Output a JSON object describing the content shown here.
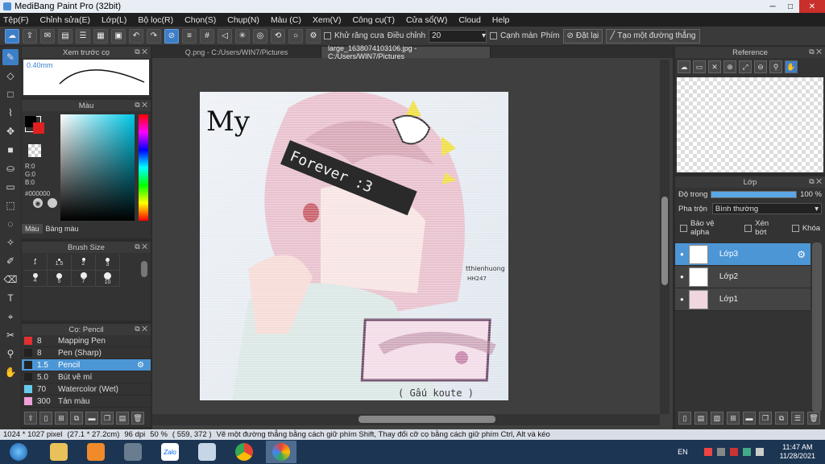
{
  "window": {
    "title": "MediBang Paint Pro (32bit)",
    "min": "─",
    "max": "□",
    "close": "✕"
  },
  "menu": [
    "Tệp(F)",
    "Chỉnh sửa(E)",
    "Lớp(L)",
    "Bộ lọc(R)",
    "Chọn(S)",
    "Chụp(N)",
    "Màu (C)",
    "Xem(V)",
    "Công cụ(T)",
    "Cửa sổ(W)",
    "Cloud",
    "Help"
  ],
  "toolbar": {
    "antialias": "Khử răng cưa",
    "adjust": "Điều chỉnh",
    "adjust_value": "20",
    "snap": "Cạnh màn",
    "key": "Phím",
    "reset": "Đặt lại",
    "straight": "Tạo một đường thẳng"
  },
  "preview": {
    "title": "Xem trước cọ",
    "size": "0.40mm"
  },
  "color": {
    "title": "Màu",
    "r": "R:0",
    "g": "G:0",
    "b": "B:0",
    "hex": "#000000",
    "tab1": "Màu",
    "tab2": "Bảng màu",
    "fg": "#000000",
    "bg": "#e02020"
  },
  "brushsize": {
    "title": "Brush Size",
    "labels": [
      "1",
      "1.5",
      "2",
      "3",
      "4",
      "5",
      "7",
      "10"
    ]
  },
  "brushes": {
    "title": "Cọ: Pencil",
    "items": [
      {
        "size": "8",
        "name": "Mapping Pen",
        "color": "#e03030"
      },
      {
        "size": "8",
        "name": "Pen (Sharp)",
        "color": "#222222"
      },
      {
        "size": "1.5",
        "name": "Pencil",
        "color": "#222222",
        "active": true
      },
      {
        "size": "5.0",
        "name": "Bút vẽ mí",
        "color": "#222222"
      },
      {
        "size": "70",
        "name": "Watercolor (Wet)",
        "color": "#66ccee"
      },
      {
        "size": "300",
        "name": "Tán màu",
        "color": "#f0a0d8"
      }
    ]
  },
  "tabs": {
    "t1": "Q.png - C:/Users/WIN7/Pictures",
    "t2": "large_1638074103106.jpg - C:/Users/WIN7/Pictures"
  },
  "art": {
    "title": "My",
    "banner": "Forever :3",
    "signature": "tthienhuong",
    "sig2": "HH247",
    "footer": "( Gấu koute )"
  },
  "reference": {
    "title": "Reference"
  },
  "layers": {
    "title": "Lớp",
    "opacity_label": "Độ trong",
    "opacity": "100 %",
    "opacity_value": 1.0,
    "blend_label": "Pha trộn",
    "blend": "Bình thường",
    "protect": "Bảo vệ alpha",
    "clip": "Xén bớt",
    "lock": "Khóa",
    "items": [
      {
        "name": "Lớp3",
        "active": true
      },
      {
        "name": "Lớp2"
      },
      {
        "name": "Lớp1"
      }
    ]
  },
  "status": {
    "dims": "1024 * 1027 pixel",
    "size": "(27.1 * 27.2cm)",
    "dpi": "96 dpi",
    "zoom": "50 %",
    "pos": "( 559, 372 )",
    "hint": "Vẽ một đường thẳng bằng cách giữ phím Shift, Thay đổi cỡ cọ bằng cách giữ phím Ctrl, Alt và kéo"
  },
  "taskbar": {
    "lang": "EN",
    "time": "11:47 AM",
    "date": "11/28/2021",
    "zalo": "Zalo"
  }
}
